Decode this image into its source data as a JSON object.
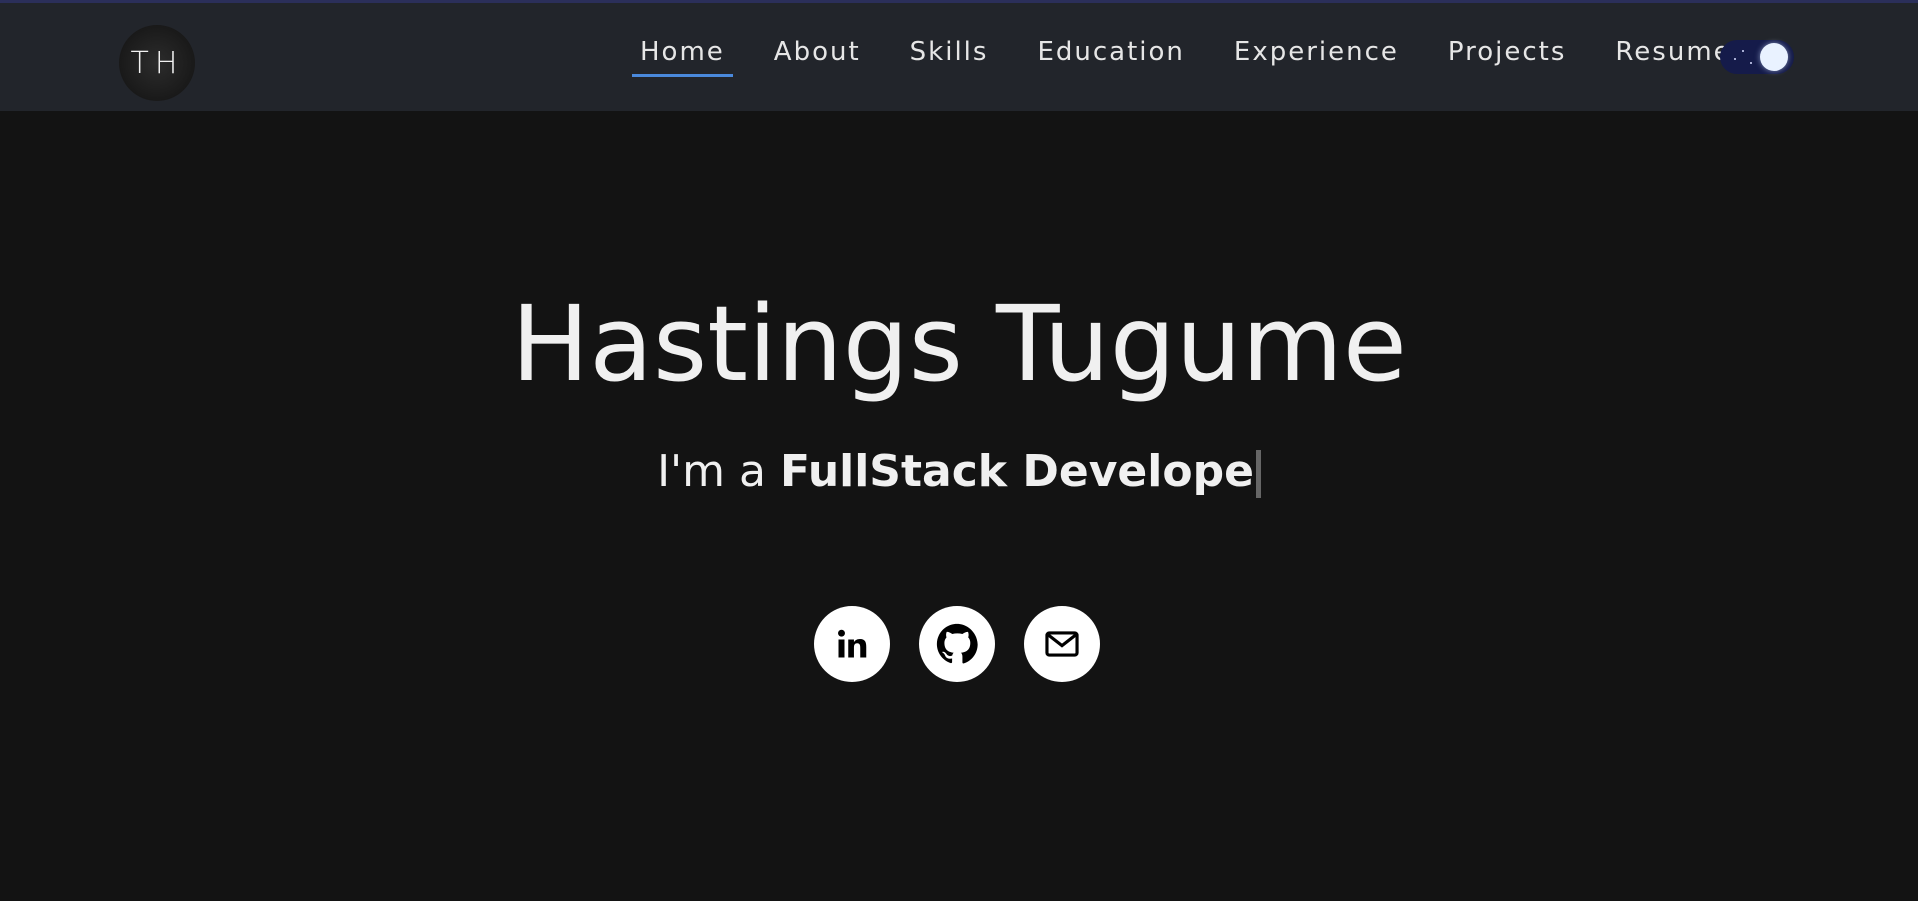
{
  "header": {
    "logo_text": "TH",
    "nav": [
      {
        "label": "Home",
        "active": true
      },
      {
        "label": "About",
        "active": false
      },
      {
        "label": "Skills",
        "active": false
      },
      {
        "label": "Education",
        "active": false
      },
      {
        "label": "Experience",
        "active": false
      },
      {
        "label": "Projects",
        "active": false
      },
      {
        "label": "Resume",
        "active": false
      }
    ],
    "theme_toggle": {
      "state": "dark",
      "icon": "moon-icon"
    }
  },
  "hero": {
    "name": "Hastings Tugume",
    "subtitle_prefix": "I'm a ",
    "subtitle_typed": "FullStack Develope"
  },
  "socials": [
    {
      "name": "LinkedIn",
      "icon": "linkedin-icon"
    },
    {
      "name": "GitHub",
      "icon": "github-icon"
    },
    {
      "name": "Email",
      "icon": "mail-icon"
    }
  ],
  "colors": {
    "background": "#131313",
    "navbar": "#22252b",
    "accent": "#4a89dc",
    "text": "#f0f0f0",
    "toggle": "#151b4a"
  }
}
